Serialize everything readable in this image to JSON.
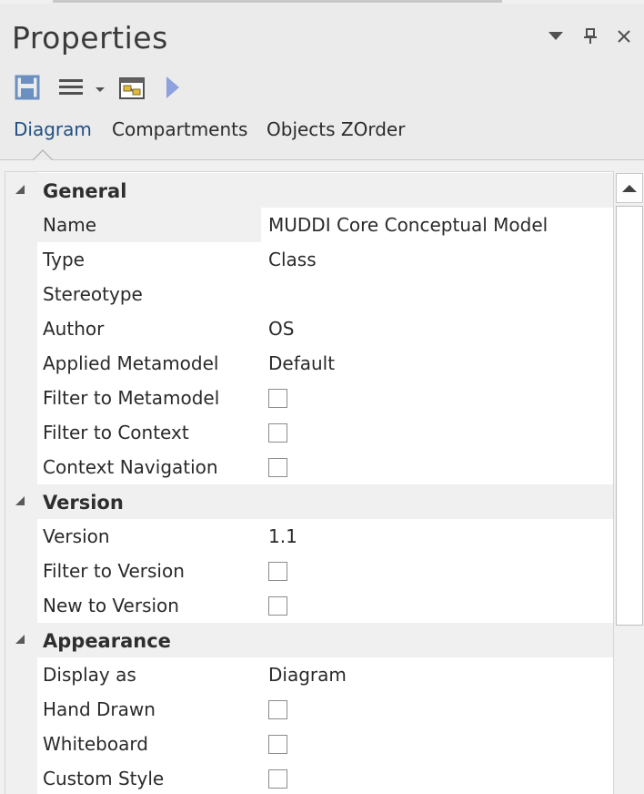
{
  "panel": {
    "title": "Properties"
  },
  "toolbar": {
    "save": "save-icon",
    "menu": "hamburger-icon",
    "diagram_props": "diagram-properties-icon",
    "run": "play-icon"
  },
  "tabs": [
    {
      "label": "Diagram",
      "active": true
    },
    {
      "label": "Compartments",
      "active": false
    },
    {
      "label": "Objects ZOrder",
      "active": false
    }
  ],
  "sections": {
    "general": {
      "label": "General",
      "props": {
        "name": {
          "label": "Name",
          "value": "MUDDI Core Conceptual Model"
        },
        "type": {
          "label": "Type",
          "value": "Class"
        },
        "stereotype": {
          "label": "Stereotype",
          "value": ""
        },
        "author": {
          "label": "Author",
          "value": "OS"
        },
        "metamodel": {
          "label": "Applied Metamodel",
          "value": "Default"
        },
        "filter_metamodel": {
          "label": "Filter to Metamodel",
          "checked": false
        },
        "filter_context": {
          "label": "Filter to Context",
          "checked": false
        },
        "context_nav": {
          "label": "Context Navigation",
          "checked": false
        }
      }
    },
    "version": {
      "label": "Version",
      "props": {
        "version": {
          "label": "Version",
          "value": "1.1"
        },
        "filter_version": {
          "label": "Filter to Version",
          "checked": false
        },
        "new_version": {
          "label": "New to Version",
          "checked": false
        }
      }
    },
    "appearance": {
      "label": "Appearance",
      "props": {
        "display_as": {
          "label": "Display as",
          "value": "Diagram"
        },
        "hand_drawn": {
          "label": "Hand Drawn",
          "checked": false
        },
        "whiteboard": {
          "label": "Whiteboard",
          "checked": false
        },
        "custom_style": {
          "label": "Custom Style",
          "checked": false
        }
      }
    }
  },
  "colors": {
    "active_tab": "#1f4f86",
    "save_icon": "#2d6db5",
    "play_icon": "#7b8fd8"
  }
}
